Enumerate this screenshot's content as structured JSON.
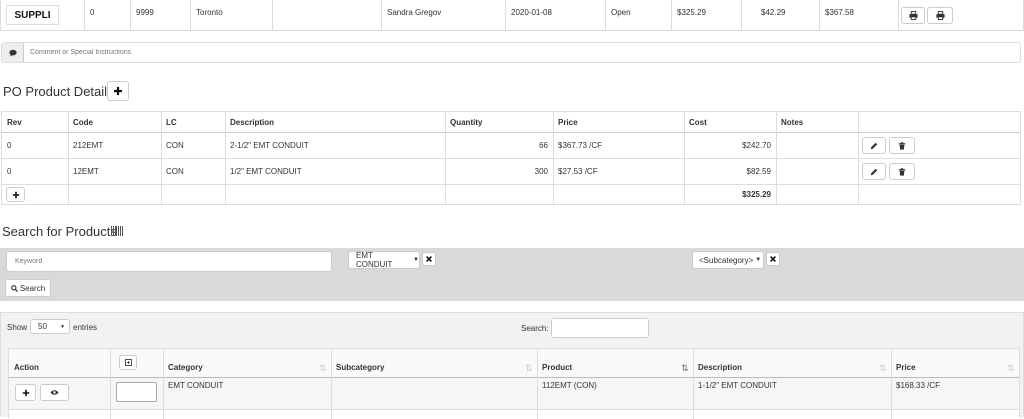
{
  "header_row": {
    "name": "SUPPLI",
    "col2": "0",
    "col3": "9999",
    "city": "Toronto",
    "buyer": "Sandra Gregov",
    "date": "2020-01-08",
    "status": "Open",
    "subtotal": "$325.29",
    "tax": "$42.29",
    "total": "$367.58"
  },
  "comment": {
    "placeholder": "Comment or Special Instructions"
  },
  "po_details": {
    "title": "PO Product Details",
    "columns": [
      "Rev",
      "Code",
      "LC",
      "Description",
      "Quantity",
      "Price",
      "Cost",
      "Notes"
    ],
    "rows": [
      {
        "rev": "0",
        "code": "212EMT",
        "lc": "CON",
        "description": "2-1/2\" EMT CONDUIT",
        "quantity": "66",
        "price": "$367.73 /CF",
        "cost": "$242.70",
        "notes": ""
      },
      {
        "rev": "0",
        "code": "12EMT",
        "lc": "CON",
        "description": "1/2\" EMT CONDUIT",
        "quantity": "300",
        "price": "$27.53 /CF",
        "cost": "$82.59",
        "notes": ""
      }
    ],
    "total_cost": "$325.29"
  },
  "search": {
    "title": "Search for Products",
    "keyword_placeholder": "Keyword",
    "category": "EMT CONDUIT",
    "subcategory": "<Subcategory>",
    "search_button": "Search"
  },
  "results": {
    "show_label": "Show",
    "entries_value": "50",
    "entries_label": "entries",
    "search_label": "Search:",
    "columns": [
      "Action",
      "Category",
      "Subcategory",
      "Product",
      "Description",
      "Price"
    ],
    "rows": [
      {
        "category": "EMT CONDUIT",
        "subcategory": "",
        "product": "112EMT (CON)",
        "description": "1-1/2\" EMT CONDUIT",
        "price": "$168.33 /CF"
      }
    ]
  },
  "icons": {
    "print": "print-icon",
    "comment": "comment-icon",
    "plus": "plus-icon",
    "edit": "pencil-icon",
    "delete": "trash-icon",
    "barcode": "barcode-icon",
    "search": "search-icon",
    "view": "eye-icon",
    "close": "close-icon"
  }
}
